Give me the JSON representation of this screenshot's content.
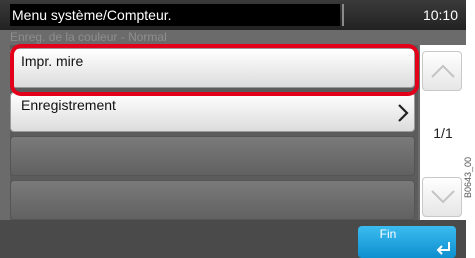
{
  "header": {
    "title": "Menu système/Compteur.",
    "clock": "10:10",
    "breadcrumb": "Enreg. de la couleur - Normal"
  },
  "list": {
    "items": [
      {
        "label": "Impr. mire",
        "has_submenu": false,
        "highlighted": true
      },
      {
        "label": "Enregistrement",
        "has_submenu": true,
        "highlighted": false
      }
    ],
    "empty_rows": 2
  },
  "scroll": {
    "up_icon": "chevron-up-icon",
    "down_icon": "chevron-down-icon",
    "page_indicator": "1/1"
  },
  "footer": {
    "fin_label": "Fin",
    "enter_icon": "enter-return-icon"
  },
  "side_code": "B0643_00",
  "colors": {
    "highlight": "#e3001b",
    "fin_button": "#1aa3e0",
    "panel": "#6b6b6b"
  }
}
